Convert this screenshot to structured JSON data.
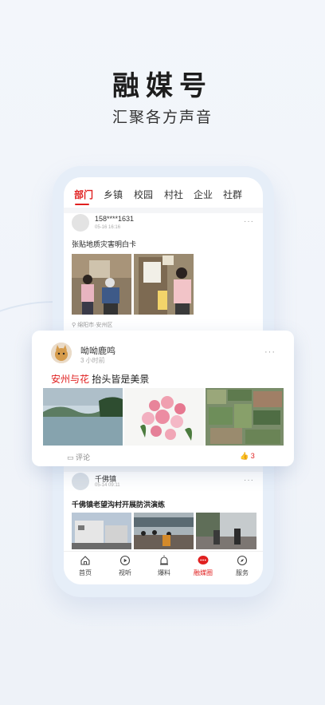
{
  "hero": {
    "title": "融媒号",
    "subtitle": "汇聚各方声音"
  },
  "tabs": [
    "部门",
    "乡镇",
    "校园",
    "村社",
    "企业",
    "社群"
  ],
  "posts": [
    {
      "user": "158****1631",
      "time": "05-16 16:16",
      "title": "张贴地质灾害明白卡",
      "location": "绵阳市·安州区"
    },
    {
      "user": "千佛镇",
      "time": "05-14 09:11",
      "title": "千佛镇老望沟村开展防洪演练"
    }
  ],
  "card": {
    "user": "呦呦鹿鸣",
    "time": "3 小时前",
    "title_highlight": "安州与花",
    "title_rest": " 抬头皆是美景",
    "comment_label": "评论",
    "like_count": "3"
  },
  "nav": [
    {
      "label": "首页",
      "icon": "home-icon"
    },
    {
      "label": "视听",
      "icon": "play-icon"
    },
    {
      "label": "爆料",
      "icon": "alarm-icon"
    },
    {
      "label": "融媒圈",
      "icon": "chat-bubble-icon",
      "active": true
    },
    {
      "label": "服务",
      "icon": "compass-icon"
    }
  ],
  "colors": {
    "accent": "#e02020",
    "text": "#222222"
  },
  "more_glyph": "···"
}
